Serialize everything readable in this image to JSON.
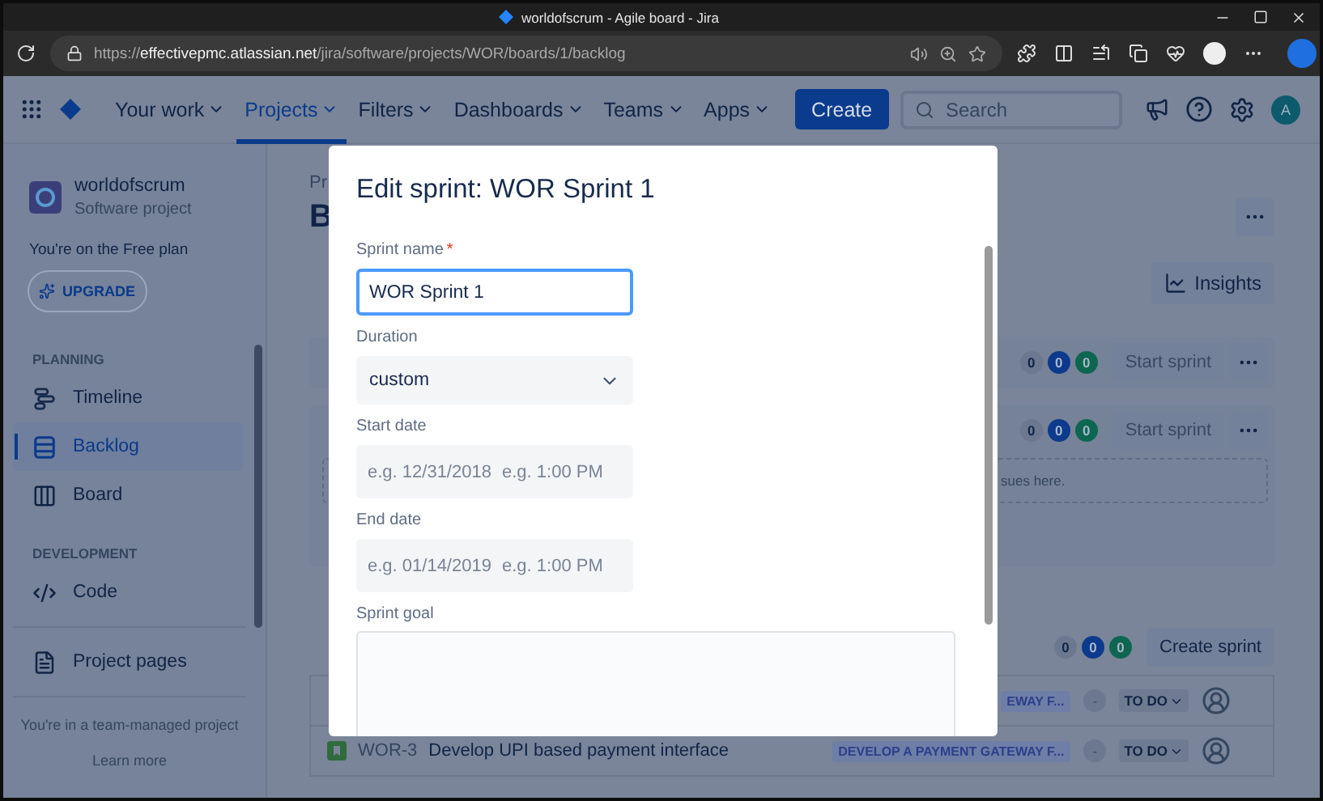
{
  "browser": {
    "tab_title": "worldofscrum - Agile board - Jira",
    "url": {
      "scheme": "https://",
      "host": "effectivepmc.atlassian.net",
      "path": "/jira/software/projects/WOR/boards/1/backlog"
    }
  },
  "nav": {
    "items": [
      {
        "label": "Your work",
        "selected": false
      },
      {
        "label": "Projects",
        "selected": true
      },
      {
        "label": "Filters",
        "selected": false
      },
      {
        "label": "Dashboards",
        "selected": false
      },
      {
        "label": "Teams",
        "selected": false
      },
      {
        "label": "Apps",
        "selected": false
      }
    ],
    "create": "Create",
    "search_placeholder": "Search",
    "avatar": "A"
  },
  "sidebar": {
    "project_name": "worldofscrum",
    "project_type": "Software project",
    "plan_note": "You're on the Free plan",
    "upgrade": "UPGRADE",
    "sections": [
      {
        "heading": "PLANNING",
        "items": [
          {
            "label": "Timeline",
            "selected": false
          },
          {
            "label": "Backlog",
            "selected": true
          },
          {
            "label": "Board",
            "selected": false
          }
        ]
      },
      {
        "heading": "DEVELOPMENT",
        "items": [
          {
            "label": "Code",
            "selected": false
          }
        ]
      }
    ],
    "pages_item": "Project pages",
    "footer_note": "You're in a team-managed project",
    "footer_link": "Learn more"
  },
  "backlog": {
    "breadcrumb": "Pr",
    "heading": "B",
    "insights": "Insights",
    "sprints": [
      {
        "counts": [
          {
            "value": "0",
            "color": "#6c788f"
          },
          {
            "value": "0",
            "color": "#0c3a8c"
          },
          {
            "value": "0",
            "color": "#0d6650"
          }
        ],
        "start": "Start sprint",
        "disabled": true
      },
      {
        "counts": [
          {
            "value": "0",
            "color": "#6c788f"
          },
          {
            "value": "0",
            "color": "#0c3a8c"
          },
          {
            "value": "0",
            "color": "#0d6650"
          }
        ],
        "start": "Start sprint",
        "disabled": true,
        "empty_note": "sues here."
      }
    ],
    "backlog_counts": [
      {
        "value": "0",
        "color": "#6c788f"
      },
      {
        "value": "0",
        "color": "#0c3a8c"
      },
      {
        "value": "0",
        "color": "#0d6650"
      }
    ],
    "create_sprint": "Create sprint",
    "rows": [
      {
        "epic": "EWAY F...",
        "estimate": "-",
        "status": "TO DO"
      },
      {
        "key": "WOR-3",
        "summary": "Develop UPI based payment interface",
        "epic": "DEVELOP A PAYMENT GATEWAY F...",
        "estimate": "-",
        "status": "TO DO"
      }
    ]
  },
  "modal": {
    "title": "Edit sprint: WOR Sprint 1",
    "fields": [
      {
        "kind": "text",
        "label": "Sprint name",
        "required_mark": "*",
        "value": "WOR Sprint 1",
        "focused": true
      },
      {
        "kind": "select",
        "label": "Duration",
        "value": "custom"
      },
      {
        "kind": "datetime",
        "label": "Start date",
        "date_placeholder": "e.g. 12/31/2018",
        "time_placeholder": "e.g. 1:00 PM"
      },
      {
        "kind": "datetime",
        "label": "End date",
        "date_placeholder": "e.g. 01/14/2019",
        "time_placeholder": "e.g. 1:00 PM"
      },
      {
        "kind": "textarea",
        "label": "Sprint goal"
      }
    ]
  }
}
